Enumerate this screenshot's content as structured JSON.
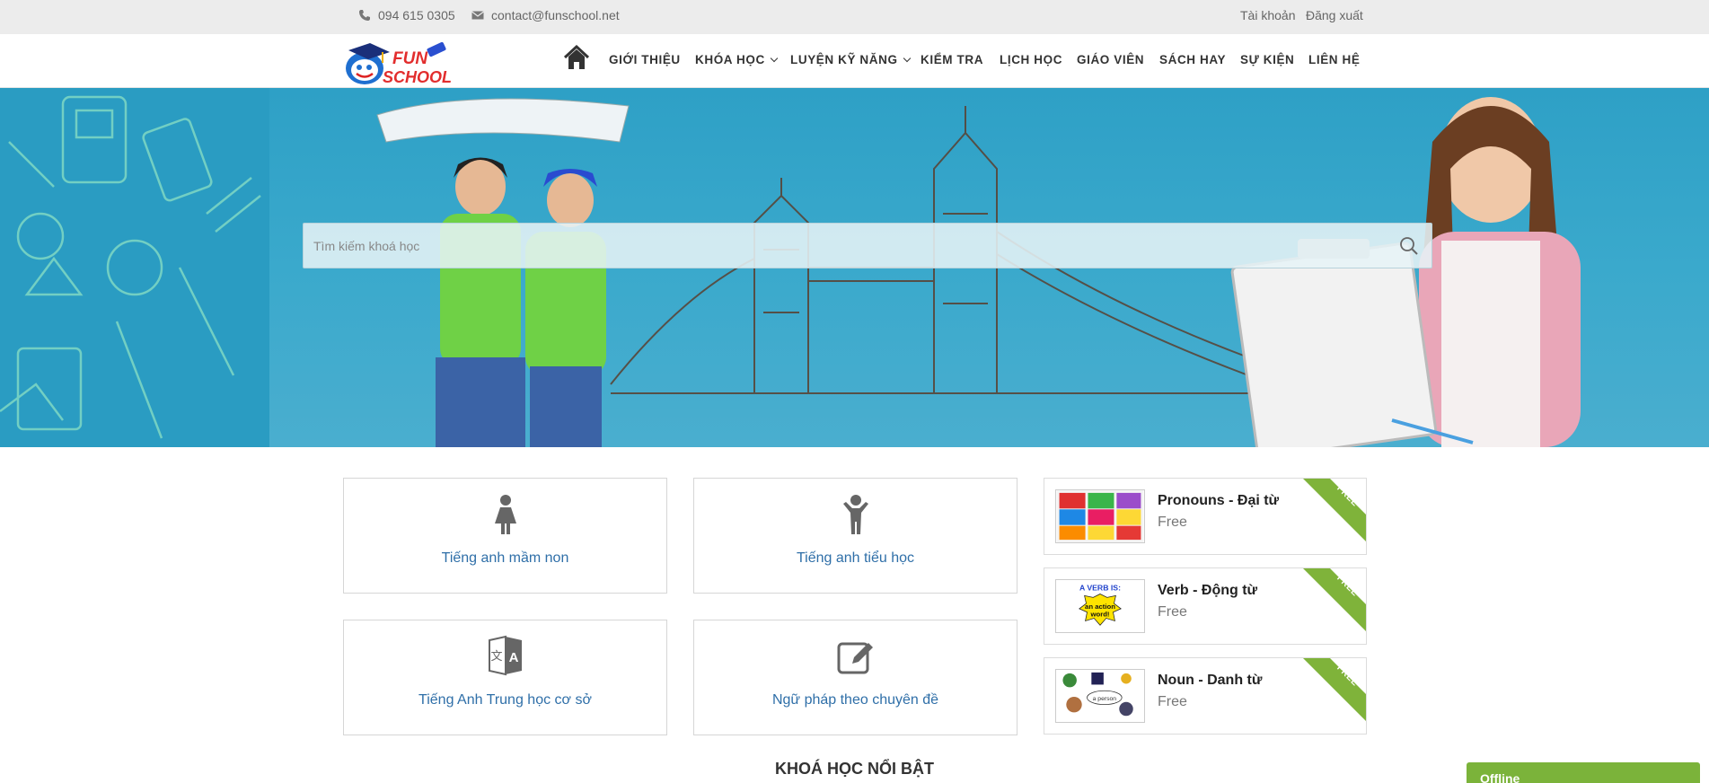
{
  "topbar": {
    "phone": "094 615 0305",
    "email": "contact@funschool.net",
    "account_link": "Tài khoản",
    "logout_link": "Đăng xuất"
  },
  "brand": {
    "logo_word_1": "FUN",
    "logo_word_2": "SCHOOL"
  },
  "nav": {
    "items": [
      {
        "label": "GIỚI THIỆU"
      },
      {
        "label": "KHÓA HỌC"
      },
      {
        "label": "LUYỆN KỸ NĂNG"
      },
      {
        "label": "KIỂM TRA"
      },
      {
        "label": "LỊCH HỌC"
      },
      {
        "label": "GIÁO VIÊN"
      },
      {
        "label": "SÁCH HAY"
      },
      {
        "label": "SỰ KIỆN"
      },
      {
        "label": "LIÊN HỆ"
      }
    ]
  },
  "search": {
    "placeholder": "Tìm kiếm khoá học"
  },
  "categories": [
    {
      "label": "Tiếng anh mầm non",
      "icon": "girl-icon"
    },
    {
      "label": "Tiếng anh tiểu học",
      "icon": "child-icon"
    },
    {
      "label": "Tiếng Anh Trung học cơ sở",
      "icon": "translate-icon"
    },
    {
      "label": "Ngữ pháp theo chuyên đề",
      "icon": "edit-icon"
    }
  ],
  "courses": [
    {
      "title": "Pronouns - Đại từ",
      "price": "Free",
      "badge": "FREE"
    },
    {
      "title": "Verb - Động từ",
      "price": "Free",
      "badge": "FREE"
    },
    {
      "title": "Noun - Danh từ",
      "price": "Free",
      "badge": "FREE"
    }
  ],
  "thumbnail_text": {
    "verb_line1": "A VERB IS:",
    "verb_line2": "an action",
    "verb_line3": "word!",
    "noun_label": "a person"
  },
  "featured_title": "KHOÁ HỌC NỔI BẬT",
  "chat_status": "Offline",
  "colors": {
    "accent_green": "#7bb33a",
    "link_blue": "#2f6fa8",
    "hero_blue": "#35a5ca"
  }
}
